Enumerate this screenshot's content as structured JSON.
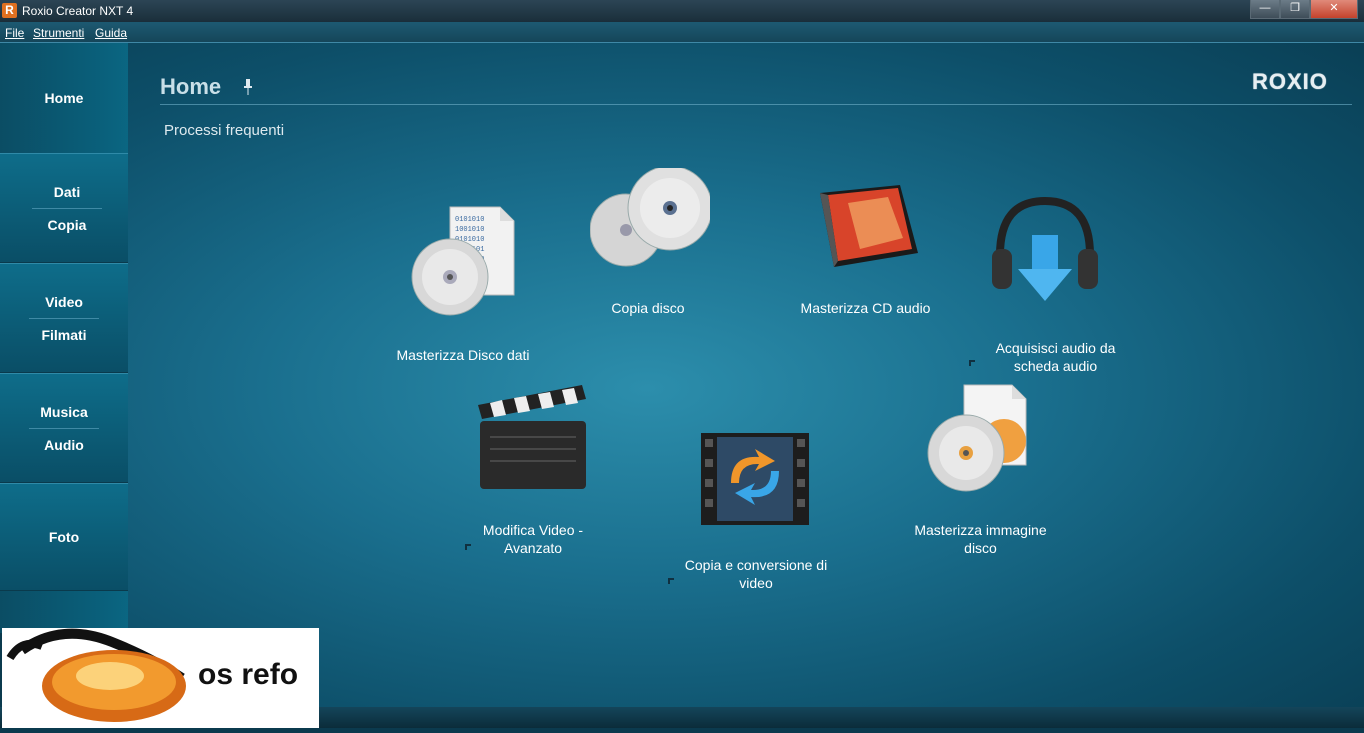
{
  "window": {
    "title": "Roxio Creator NXT 4",
    "app_icon": "R"
  },
  "window_buttons": {
    "minimize": "—",
    "maximize": "❐",
    "close": "✕"
  },
  "menu": [
    "File",
    "Strumenti",
    "Guida"
  ],
  "sidebar": [
    {
      "line1": "Home",
      "line2": ""
    },
    {
      "line1": "Dati",
      "line2": "Copia"
    },
    {
      "line1": "Video",
      "line2": "Filmati"
    },
    {
      "line1": "Musica",
      "line2": "Audio"
    },
    {
      "line1": "Foto",
      "line2": ""
    }
  ],
  "header": {
    "title": "Home",
    "logo": "ROXIO"
  },
  "section_title": "Processi frequenti",
  "tasks": [
    {
      "label": "Masterizza Disco dati",
      "icon": "data-disc-icon"
    },
    {
      "label": "Copia disco",
      "icon": "copy-disc-icon"
    },
    {
      "label": "Masterizza CD audio",
      "icon": "audio-cd-icon"
    },
    {
      "label": "Acquisisci audio da scheda audio",
      "icon": "headphones-download-icon"
    },
    {
      "label": "Modifica Video - Avanzato",
      "icon": "clapperboard-icon"
    },
    {
      "label": "Copia e conversione di video",
      "icon": "video-convert-icon"
    },
    {
      "label": "Masterizza immagine disco",
      "icon": "disc-image-icon"
    }
  ],
  "watermark": {
    "text": "os refo"
  },
  "colors": {
    "accent": "#1a6f8e",
    "sidebar": "#0a5f7a",
    "highlight": "#2c8eac"
  }
}
